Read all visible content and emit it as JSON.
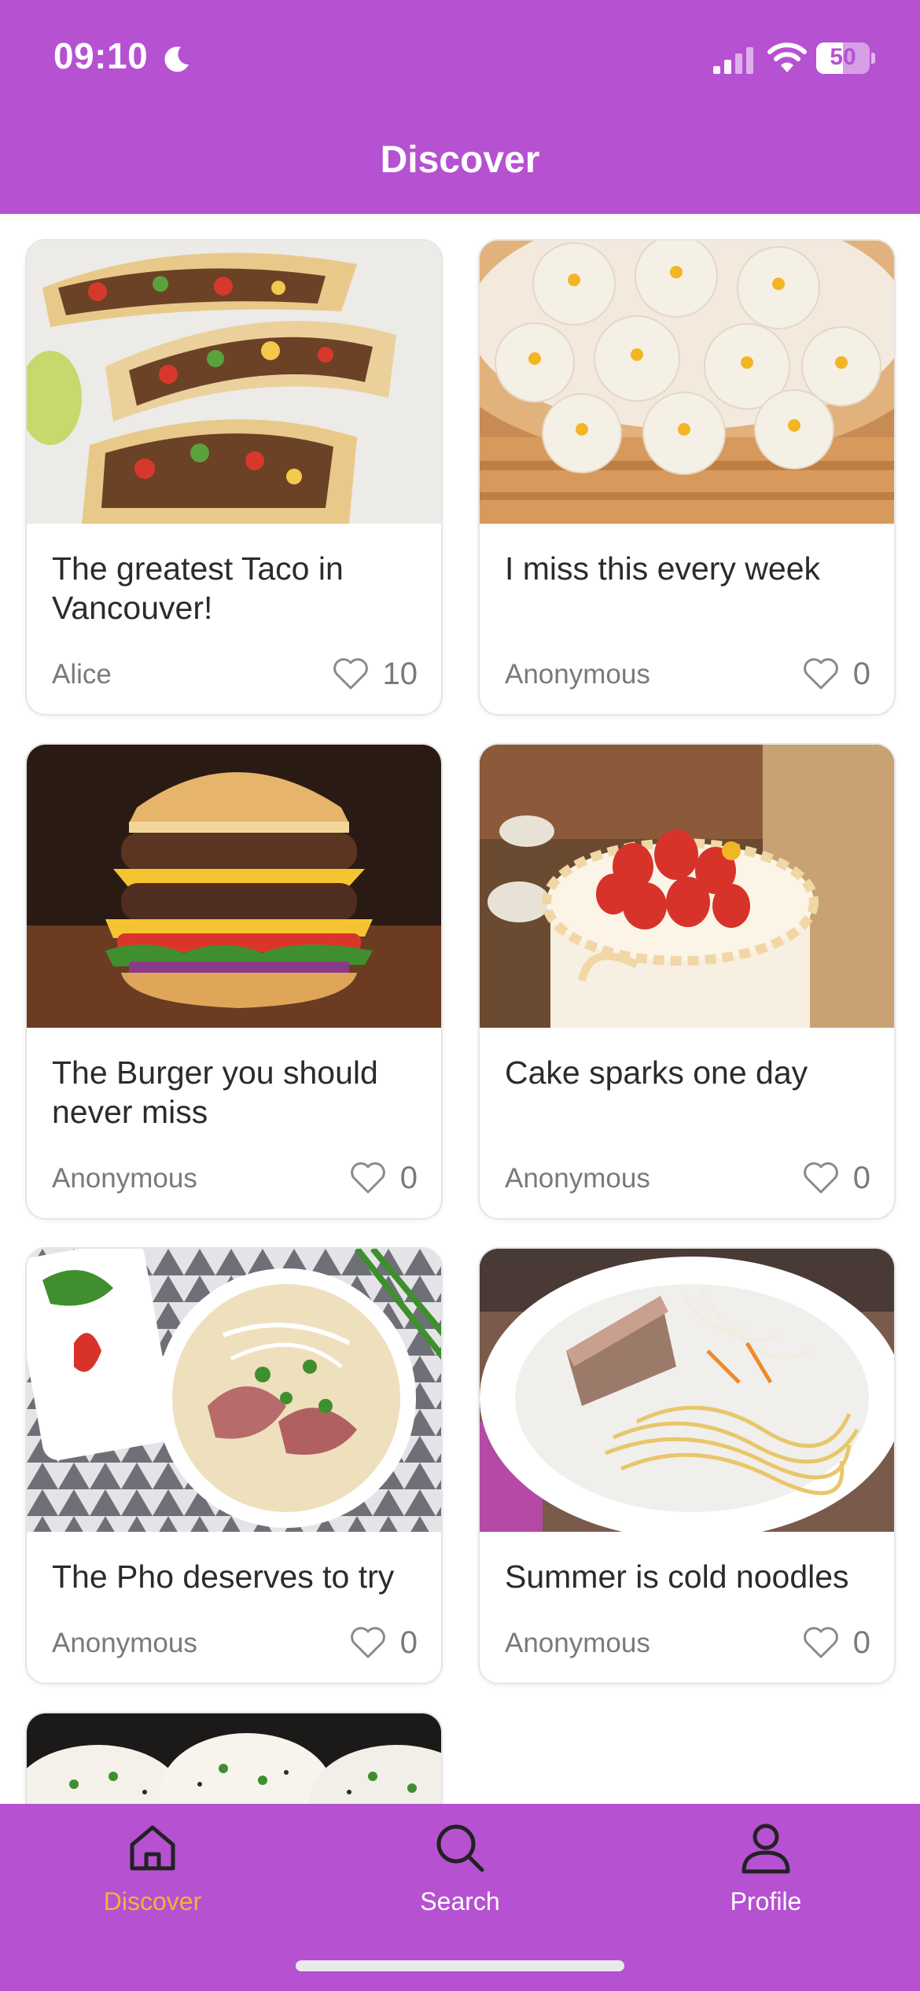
{
  "status_bar": {
    "time": "09:10",
    "battery": "50",
    "battery_level": 0.5
  },
  "header": {
    "title": "Discover"
  },
  "posts": [
    {
      "title": "The greatest Taco in Vancouver!",
      "author": "Alice",
      "likes": "10",
      "image": "tacos-photo"
    },
    {
      "title": "I miss this every week",
      "author": "Anonymous",
      "likes": "0",
      "image": "soup-dumplings-photo"
    },
    {
      "title": "The Burger you should never miss",
      "author": "Anonymous",
      "likes": "0",
      "image": "burger-photo"
    },
    {
      "title": "Cake sparks one day",
      "author": "Anonymous",
      "likes": "0",
      "image": "strawberry-cake-photo"
    },
    {
      "title": "The Pho deserves to try",
      "author": "Anonymous",
      "likes": "0",
      "image": "pho-photo"
    },
    {
      "title": "Summer is cold noodles",
      "author": "Anonymous",
      "likes": "0",
      "image": "cold-noodles-photo"
    },
    {
      "image": "buns-photo"
    }
  ],
  "bottom_nav": {
    "items": [
      {
        "label": "Discover",
        "icon": "home-icon",
        "active": true
      },
      {
        "label": "Search",
        "icon": "search-icon",
        "active": false
      },
      {
        "label": "Profile",
        "icon": "person-icon",
        "active": false
      }
    ]
  },
  "colors": {
    "primary": "#b651d2",
    "active_tab": "#f7b133",
    "text": "#2b2b2b",
    "muted": "#7a7a7a"
  }
}
